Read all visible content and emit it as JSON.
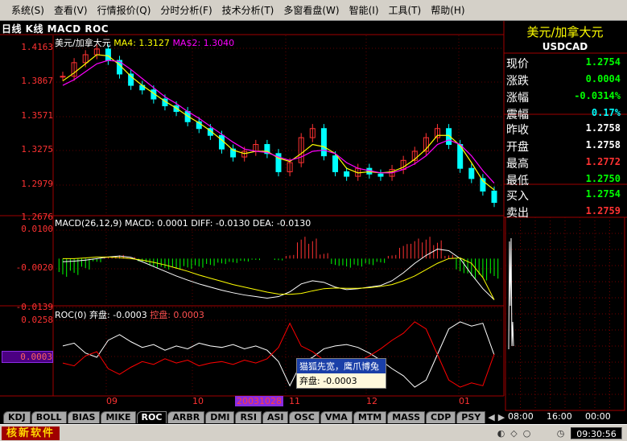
{
  "menubar": {
    "items": [
      "系统(S)",
      "查看(V)",
      "行情报价(Q)",
      "分时分析(F)",
      "技术分析(T)",
      "多窗看盘(W)",
      "智能(I)",
      "工具(T)",
      "帮助(H)"
    ]
  },
  "chart_header": {
    "title": "日线 K线 MACD ROC"
  },
  "price_panel": {
    "legend_name": "美元/加拿大元",
    "ma4_label": "MA4: 1.3127",
    "ma42_label": "MA$2: 1.3040",
    "y_ticks": [
      "1.4163",
      "1.3867",
      "1.3571",
      "1.3275",
      "1.2979",
      "1.2676"
    ]
  },
  "macd_panel": {
    "legend_text": "MACD(26,12,9) MACD: 0.0001  DIFF: -0.0130  DEA: -0.0130",
    "y_ticks": [
      "0.0100",
      "-0.0020",
      "-0.0139"
    ]
  },
  "roc_panel": {
    "legend_main": "ROC(0) 弃盘: -0.0003",
    "legend_red": "控盘: 0.0003",
    "y_ticks": [
      "0.0258",
      "0.0003"
    ]
  },
  "tooltip": {
    "title": "猫狐先宽，鹰爪博兔",
    "body": "弃盘: -0.0003"
  },
  "x_axis": {
    "labels": [
      "09",
      "10",
      "20031028",
      "11",
      "12",
      "01"
    ]
  },
  "tabs": [
    "KDJ",
    "BOLL",
    "BIAS",
    "MIKE",
    "ROC",
    "ARBR",
    "DMI",
    "RSI",
    "ASI",
    "OSC",
    "VMA",
    "MTM",
    "MASS",
    "CDP",
    "PSY"
  ],
  "active_tab": "ROC",
  "quote": {
    "name": "美元/加拿大元",
    "code": "USDCAD",
    "rows": [
      {
        "label": "现价",
        "value": "1.2754",
        "color": "#00ff00"
      },
      {
        "label": "涨跌",
        "value": "0.0004",
        "color": "#00ff00"
      },
      {
        "label": "涨幅",
        "value": "-0.0314%",
        "color": "#00ff00"
      },
      {
        "label": "震幅",
        "value": "0.17%",
        "color": "#00ffff"
      },
      {
        "label": "昨收",
        "value": "1.2758",
        "color": "#ffffff"
      },
      {
        "label": "开盘",
        "value": "1.2758",
        "color": "#ffffff"
      },
      {
        "label": "最高",
        "value": "1.2772",
        "color": "#ff3232"
      },
      {
        "label": "最低",
        "value": "1.2750",
        "color": "#00ff00"
      },
      {
        "label": "买入",
        "value": "1.2754",
        "color": "#00ff00"
      },
      {
        "label": "卖出",
        "value": "1.2759",
        "color": "#ff3232"
      }
    ]
  },
  "mini_chart": {
    "time_labels": [
      "08:00",
      "16:00",
      "00:00"
    ]
  },
  "statusbar": {
    "brand": "核新软件",
    "time": "09:30:56"
  },
  "colors": {
    "up_candle": "#ff3232",
    "down_candle": "#00ffff",
    "ma4": "#ffff00",
    "ma42": "#ff00ff",
    "macd_up": "#ff3232",
    "macd_down": "#00ff00",
    "diff_line": "#ffffff",
    "dea_line": "#ffff00",
    "roc_white": "#ffffff",
    "roc_red": "#ff0000",
    "grid": "#a00000"
  },
  "chart_data": [
    {
      "type": "candlestick",
      "title": "美元/加拿大元",
      "ylim": [
        1.2676,
        1.4163
      ],
      "x": [
        "2003-08-20",
        "2003-08-24",
        "2003-08-28",
        "2003-09-01",
        "2003-09-05",
        "2003-09-09",
        "2003-09-13",
        "2003-09-17",
        "2003-09-21",
        "2003-09-25",
        "2003-09-29",
        "2003-10-03",
        "2003-10-07",
        "2003-10-11",
        "2003-10-15",
        "2003-10-19",
        "2003-10-23",
        "2003-10-27",
        "2003-10-31",
        "2003-11-04",
        "2003-11-08",
        "2003-11-12",
        "2003-11-16",
        "2003-11-20",
        "2003-11-24",
        "2003-11-28",
        "2003-12-02",
        "2003-12-06",
        "2003-12-10",
        "2003-12-14",
        "2003-12-18",
        "2003-12-22",
        "2003-12-26",
        "2003-12-30",
        "2004-01-03",
        "2004-01-07",
        "2004-01-11",
        "2004-01-15",
        "2004-01-19"
      ],
      "close": [
        1.386,
        1.398,
        1.405,
        1.41,
        1.4,
        1.388,
        1.378,
        1.374,
        1.366,
        1.36,
        1.355,
        1.346,
        1.34,
        1.334,
        1.322,
        1.315,
        1.32,
        1.326,
        1.318,
        1.302,
        1.31,
        1.332,
        1.34,
        1.316,
        1.302,
        1.298,
        1.305,
        1.3,
        1.298,
        1.304,
        1.312,
        1.32,
        1.332,
        1.34,
        1.326,
        1.305,
        1.296,
        1.285,
        1.275
      ],
      "series": [
        {
          "name": "MA4",
          "values": [
            1.382,
            1.389,
            1.397,
            1.405,
            1.404,
            1.396,
            1.386,
            1.378,
            1.371,
            1.364,
            1.358,
            1.351,
            1.345,
            1.338,
            1.33,
            1.321,
            1.318,
            1.32,
            1.32,
            1.314,
            1.311,
            1.318,
            1.326,
            1.324,
            1.318,
            1.305,
            1.301,
            1.302,
            1.301,
            1.302,
            1.306,
            1.313,
            1.322,
            1.334,
            1.334,
            1.325,
            1.31,
            1.294,
            1.286
          ]
        },
        {
          "name": "MA$2",
          "values": [
            1.378,
            1.383,
            1.39,
            1.397,
            1.4,
            1.399,
            1.392,
            1.384,
            1.376,
            1.368,
            1.362,
            1.355,
            1.349,
            1.342,
            1.335,
            1.328,
            1.322,
            1.32,
            1.319,
            1.315,
            1.312,
            1.315,
            1.32,
            1.321,
            1.318,
            1.31,
            1.305,
            1.303,
            1.301,
            1.301,
            1.304,
            1.309,
            1.316,
            1.326,
            1.33,
            1.326,
            1.316,
            1.303,
            1.292
          ]
        }
      ]
    },
    {
      "type": "bar",
      "title": "MACD(26,12,9)",
      "ylim": [
        -0.0139,
        0.01
      ],
      "values": [
        -0.005,
        -0.0045,
        -0.003,
        -0.001,
        0.0005,
        0.001,
        0.0004,
        -0.001,
        -0.0025,
        -0.003,
        -0.003,
        -0.0028,
        -0.0025,
        -0.002,
        -0.0015,
        -0.0012,
        -0.0008,
        -0.0004,
        0.0,
        -0.0005,
        0.001,
        0.006,
        0.0055,
        0.0015,
        -0.002,
        -0.0025,
        -0.0022,
        -0.0018,
        -0.0012,
        0.001,
        0.004,
        0.0055,
        0.006,
        0.005,
        0.001,
        -0.004,
        -0.0055,
        -0.006,
        -0.0055
      ],
      "series": [
        {
          "name": "DIFF",
          "values": [
            -0.001,
            -0.0008,
            -0.0005,
            0.0,
            0.0005,
            0.0008,
            0.0004,
            -0.001,
            -0.0025,
            -0.004,
            -0.0055,
            -0.0068,
            -0.008,
            -0.009,
            -0.01,
            -0.0108,
            -0.0115,
            -0.012,
            -0.0125,
            -0.012,
            -0.0105,
            -0.008,
            -0.007,
            -0.0075,
            -0.009,
            -0.0098,
            -0.0095,
            -0.009,
            -0.0085,
            -0.007,
            -0.0045,
            -0.0015,
            0.001,
            0.003,
            0.0025,
            0.0,
            -0.005,
            -0.0095,
            -0.013
          ]
        },
        {
          "name": "DEA",
          "values": [
            0.0,
            0.0,
            0.0002,
            0.0005,
            0.0005,
            0.0003,
            0.0,
            -0.0005,
            -0.0012,
            -0.002,
            -0.003,
            -0.004,
            -0.0052,
            -0.0062,
            -0.0072,
            -0.0082,
            -0.009,
            -0.0098,
            -0.0106,
            -0.0112,
            -0.0113,
            -0.011,
            -0.0102,
            -0.0095,
            -0.0093,
            -0.0094,
            -0.0094,
            -0.0092,
            -0.0088,
            -0.0082,
            -0.007,
            -0.0055,
            -0.0035,
            -0.0015,
            0.0,
            0.0002,
            -0.0015,
            -0.006,
            -0.013
          ]
        }
      ]
    },
    {
      "type": "line",
      "title": "ROC(0)",
      "ylim": [
        -0.0258,
        0.0258
      ],
      "series": [
        {
          "name": "弃盘",
          "values": [
            0.006,
            0.008,
            0.001,
            -0.002,
            0.01,
            0.014,
            0.009,
            0.005,
            0.007,
            0.003,
            0.006,
            0.004,
            0.008,
            0.006,
            0.005,
            0.007,
            0.004,
            0.006,
            0.003,
            -0.005,
            -0.022,
            -0.006,
            -0.002,
            0.004,
            0.006,
            0.007,
            0.005,
            0.001,
            -0.004,
            -0.01,
            -0.015,
            -0.023,
            -0.018,
            0.0,
            0.018,
            0.023,
            0.02,
            0.022,
            -0.0003
          ]
        },
        {
          "name": "控盘",
          "values": [
            -0.006,
            -0.008,
            -0.001,
            0.002,
            -0.01,
            -0.014,
            -0.009,
            -0.005,
            -0.007,
            -0.003,
            -0.006,
            -0.004,
            -0.008,
            -0.006,
            -0.005,
            -0.007,
            -0.004,
            -0.006,
            -0.003,
            0.005,
            0.022,
            0.006,
            0.002,
            -0.004,
            -0.006,
            -0.007,
            -0.005,
            -0.001,
            0.004,
            0.01,
            0.015,
            0.023,
            0.018,
            0.0,
            -0.018,
            -0.023,
            -0.02,
            -0.022,
            0.0003
          ]
        }
      ]
    }
  ]
}
